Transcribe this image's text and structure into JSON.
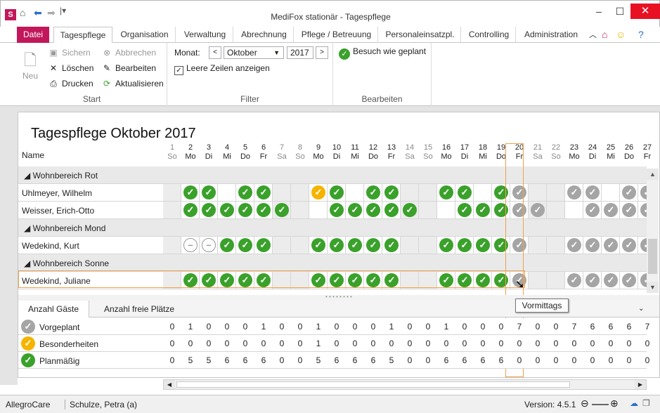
{
  "window": {
    "title": "MediFox stationär - Tagespflege"
  },
  "ribbon_tabs": [
    "Datei",
    "Tagespflege",
    "Organisation",
    "Verwaltung",
    "Abrechnung",
    "Pflege / Betreuung",
    "Personaleinsatzpl.",
    "Controlling",
    "Administration"
  ],
  "ribbon": {
    "start": {
      "label": "Start",
      "new": "Neu",
      "save": "Sichern",
      "cancel": "Abbrechen",
      "delete": "Löschen",
      "edit": "Bearbeiten",
      "print": "Drucken",
      "refresh": "Aktualisieren"
    },
    "filter": {
      "label": "Filter",
      "month_label": "Monat:",
      "month": "Oktober",
      "year": "2017",
      "empty_rows": "Leere Zeilen anzeigen"
    },
    "edit": {
      "label": "Bearbeiten",
      "visit_planned": "Besuch wie geplant"
    }
  },
  "page": {
    "title": "Tagespflege Oktober 2017",
    "name_header": "Name"
  },
  "days": [
    {
      "d": "1",
      "w": "So"
    },
    {
      "d": "2",
      "w": "Mo"
    },
    {
      "d": "3",
      "w": "Di"
    },
    {
      "d": "4",
      "w": "Mi"
    },
    {
      "d": "5",
      "w": "Do"
    },
    {
      "d": "6",
      "w": "Fr"
    },
    {
      "d": "7",
      "w": "Sa"
    },
    {
      "d": "8",
      "w": "So"
    },
    {
      "d": "9",
      "w": "Mo"
    },
    {
      "d": "10",
      "w": "Di"
    },
    {
      "d": "11",
      "w": "Mi"
    },
    {
      "d": "12",
      "w": "Do"
    },
    {
      "d": "13",
      "w": "Fr"
    },
    {
      "d": "14",
      "w": "Sa"
    },
    {
      "d": "15",
      "w": "So"
    },
    {
      "d": "16",
      "w": "Mo"
    },
    {
      "d": "17",
      "w": "Di"
    },
    {
      "d": "18",
      "w": "Mi"
    },
    {
      "d": "19",
      "w": "Do"
    },
    {
      "d": "20",
      "w": "Fr"
    },
    {
      "d": "21",
      "w": "Sa"
    },
    {
      "d": "22",
      "w": "So"
    },
    {
      "d": "23",
      "w": "Mo"
    },
    {
      "d": "24",
      "w": "Di"
    },
    {
      "d": "25",
      "w": "Mi"
    },
    {
      "d": "26",
      "w": "Do"
    },
    {
      "d": "27",
      "w": "Fr"
    }
  ],
  "rows": [
    {
      "type": "group",
      "name": "Wohnbereich Rot"
    },
    {
      "type": "person",
      "name": "Uhlmeyer, Wilhelm",
      "cells": "-gg-gg--og-gg--gg-gg--gg-gg"
    },
    {
      "type": "person",
      "name": "Weisser, Erich-Otto",
      "cells": "-gggggg--ggggg--ggggg--gggg"
    },
    {
      "type": "group",
      "name": "Wohnbereich Mond"
    },
    {
      "type": "person",
      "name": "Wedekind, Kurt",
      "cells": "-mmggg--ggggg--ggggg--ggggg"
    },
    {
      "type": "group",
      "name": "Wohnbereich Sonne"
    },
    {
      "type": "person",
      "name": "Wedekind, Juliane",
      "cells": "-ggggg--ggggg--ggggg--ggggg"
    }
  ],
  "bottom_tabs": [
    "Anzahl Gäste",
    "Anzahl freie Plätze"
  ],
  "summary": [
    {
      "name": "Vorgeplant",
      "icon": "gray",
      "values": [
        "0",
        "1",
        "0",
        "0",
        "0",
        "1",
        "0",
        "0",
        "1",
        "0",
        "0",
        "0",
        "1",
        "0",
        "0",
        "1",
        "0",
        "0",
        "0",
        "7",
        "0",
        "0",
        "7",
        "6",
        "6",
        "6",
        "7"
      ]
    },
    {
      "name": "Besonderheiten",
      "icon": "orange",
      "values": [
        "0",
        "0",
        "0",
        "0",
        "0",
        "0",
        "0",
        "0",
        "1",
        "0",
        "0",
        "0",
        "0",
        "0",
        "0",
        "0",
        "0",
        "0",
        "0",
        "0",
        "0",
        "0",
        "0",
        "0",
        "0",
        "0",
        "0"
      ]
    },
    {
      "name": "Planmäßig",
      "icon": "green",
      "values": [
        "0",
        "5",
        "5",
        "6",
        "6",
        "6",
        "0",
        "0",
        "5",
        "6",
        "6",
        "6",
        "5",
        "0",
        "0",
        "6",
        "6",
        "6",
        "6",
        "0",
        "0",
        "0",
        "0",
        "0",
        "0",
        "0",
        "0"
      ]
    }
  ],
  "tooltip": "Vormittags",
  "status": {
    "left1": "AllegroCare",
    "left2": "Schulze, Petra (a)",
    "version": "Version: 4.5.1"
  },
  "colors": {
    "accent": "#c2185b",
    "green": "#3aa12b",
    "gray": "#a5a5a5",
    "orange": "#f5b400",
    "highlight": "#f0a04b"
  }
}
